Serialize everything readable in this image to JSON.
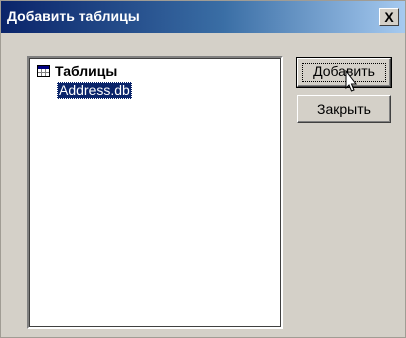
{
  "window": {
    "title": "Добавить таблицы",
    "close_label": "X"
  },
  "tree": {
    "root_label": "Таблицы",
    "root_icon": "table-icon",
    "items": [
      {
        "label": "Address.db",
        "selected": true
      }
    ]
  },
  "buttons": {
    "add_label": "Добавить",
    "close_label": "Закрыть"
  },
  "colors": {
    "title_bar_start": "#0a246a",
    "title_bar_end": "#a6caf0",
    "dialog_face": "#d4d0c8",
    "selection": "#0a246a"
  }
}
